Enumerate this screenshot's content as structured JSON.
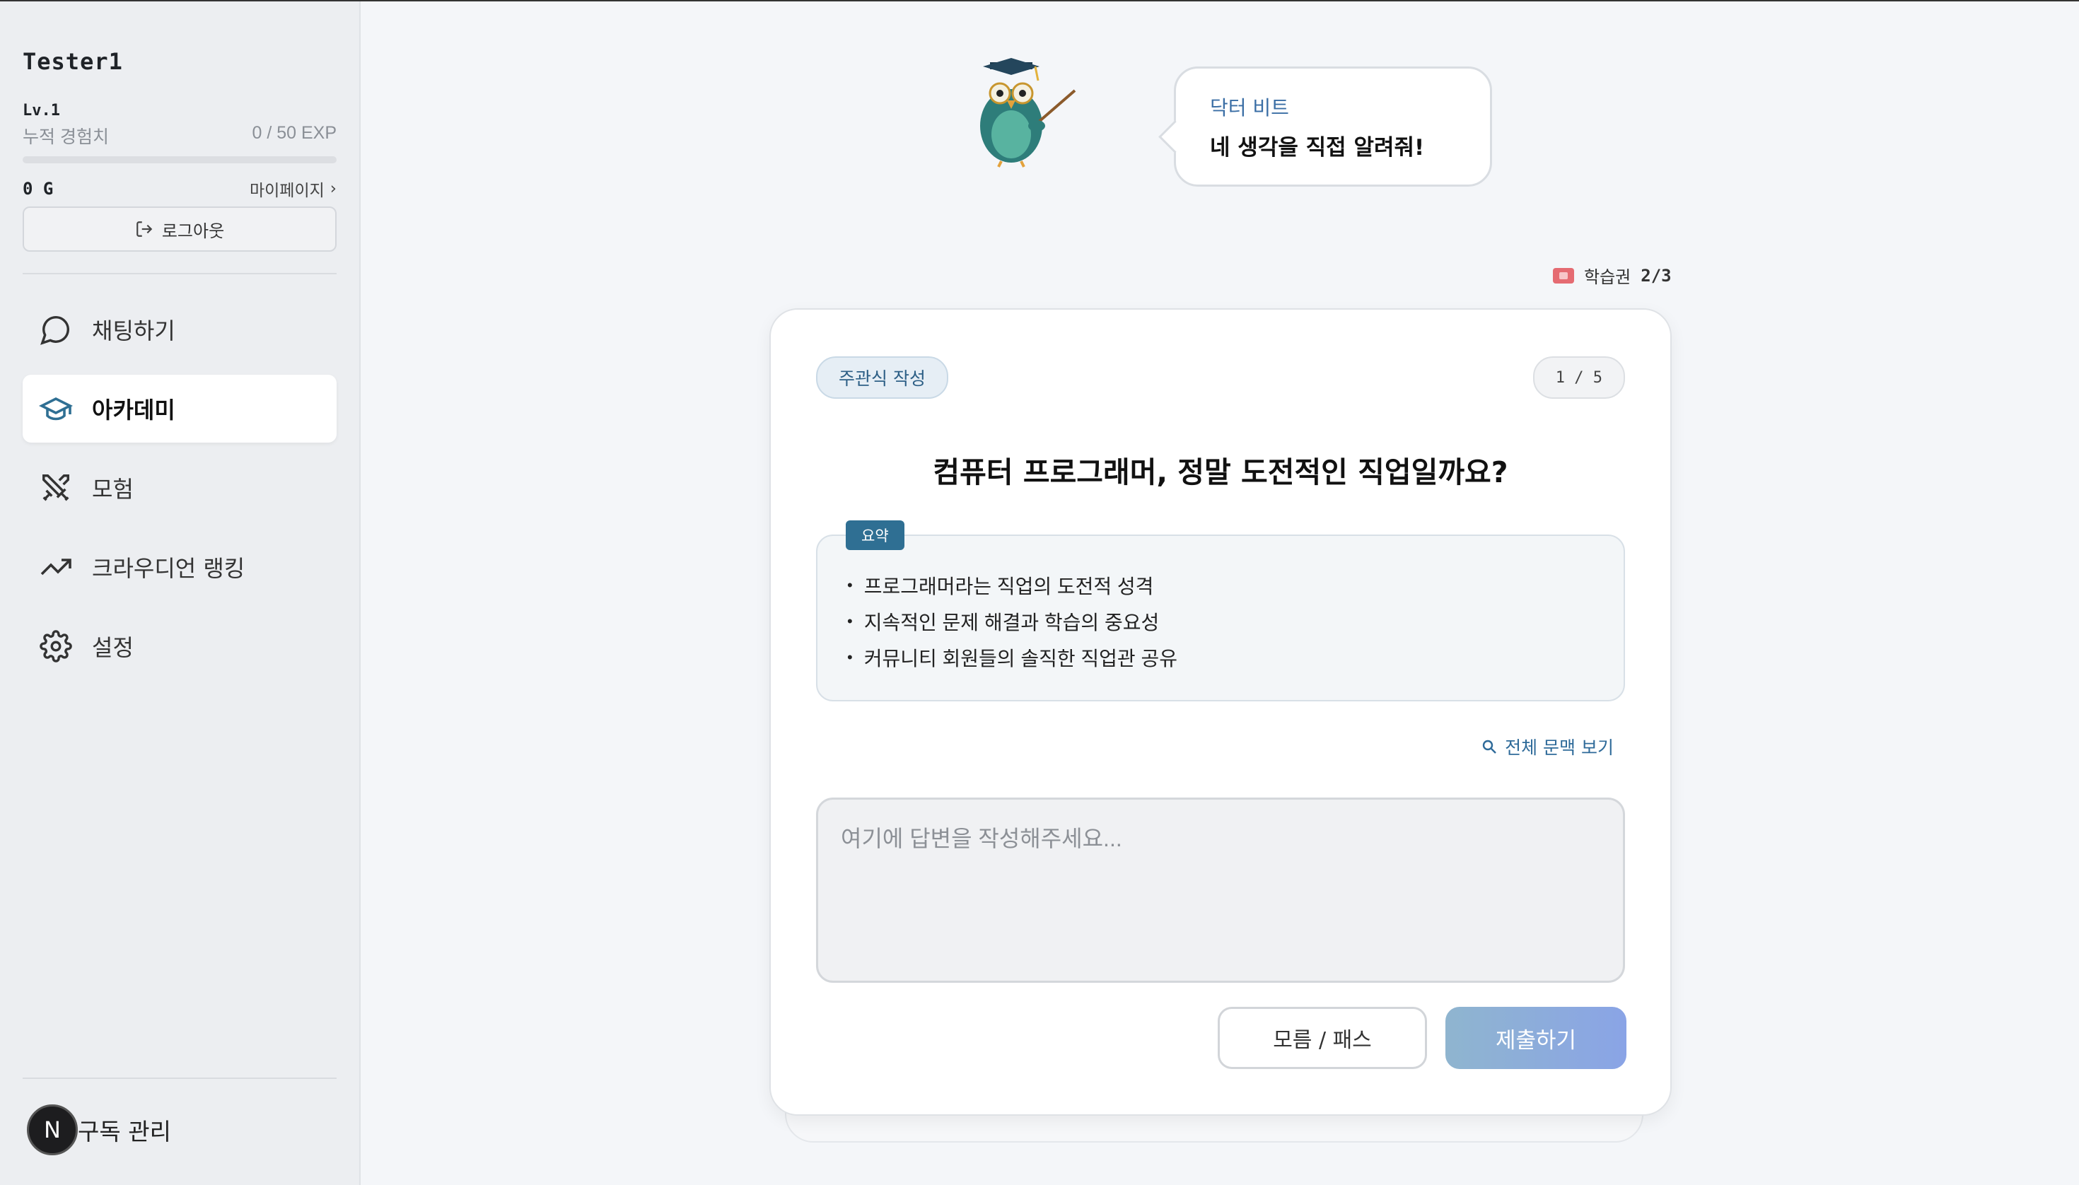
{
  "sidebar": {
    "username": "Tester1",
    "level": "Lv.1",
    "exp_label": "누적 경험치",
    "exp_value": "0 / 50 EXP",
    "exp_progress": 0,
    "gold": "0 G",
    "mypage": "마이페이지",
    "logout": "로그아웃",
    "nav": [
      {
        "label": "채팅하기",
        "icon": "chat-icon"
      },
      {
        "label": "아카데미",
        "icon": "graduation-cap-icon",
        "active": true
      },
      {
        "label": "모험",
        "icon": "crossed-swords-icon"
      },
      {
        "label": "크라우디언 랭킹",
        "icon": "trending-up-icon"
      },
      {
        "label": "설정",
        "icon": "gear-icon"
      }
    ],
    "subscription": "구독 관리",
    "avatar_letter": "N"
  },
  "mascot": {
    "name": "닥터 비트",
    "speech": "네 생각을 직접 알려줘!",
    "icon": "owl-professor-icon"
  },
  "ticket": {
    "label": "학습권",
    "count": "2/3"
  },
  "card": {
    "type_badge": "주관식 작성",
    "progress": "1 / 5",
    "question": "컴퓨터 프로그래머, 정말 도전적인 직업일까요?",
    "summary_tag": "요약",
    "summary_items": [
      "프로그래머라는 직업의 도전적 성격",
      "지속적인 문제 해결과 학습의 중요성",
      "커뮤니티 회원들의 솔직한 직업관 공유"
    ],
    "context_link": "전체 문맥 보기",
    "answer_placeholder": "여기에 답변을 작성해주세요...",
    "pass_button": "모름 / 패스",
    "submit_button": "제출하기"
  },
  "colors": {
    "accent": "#2f6f93",
    "submit_gradient_start": "#8fb5cf",
    "submit_gradient_end": "#8aa4e6"
  }
}
